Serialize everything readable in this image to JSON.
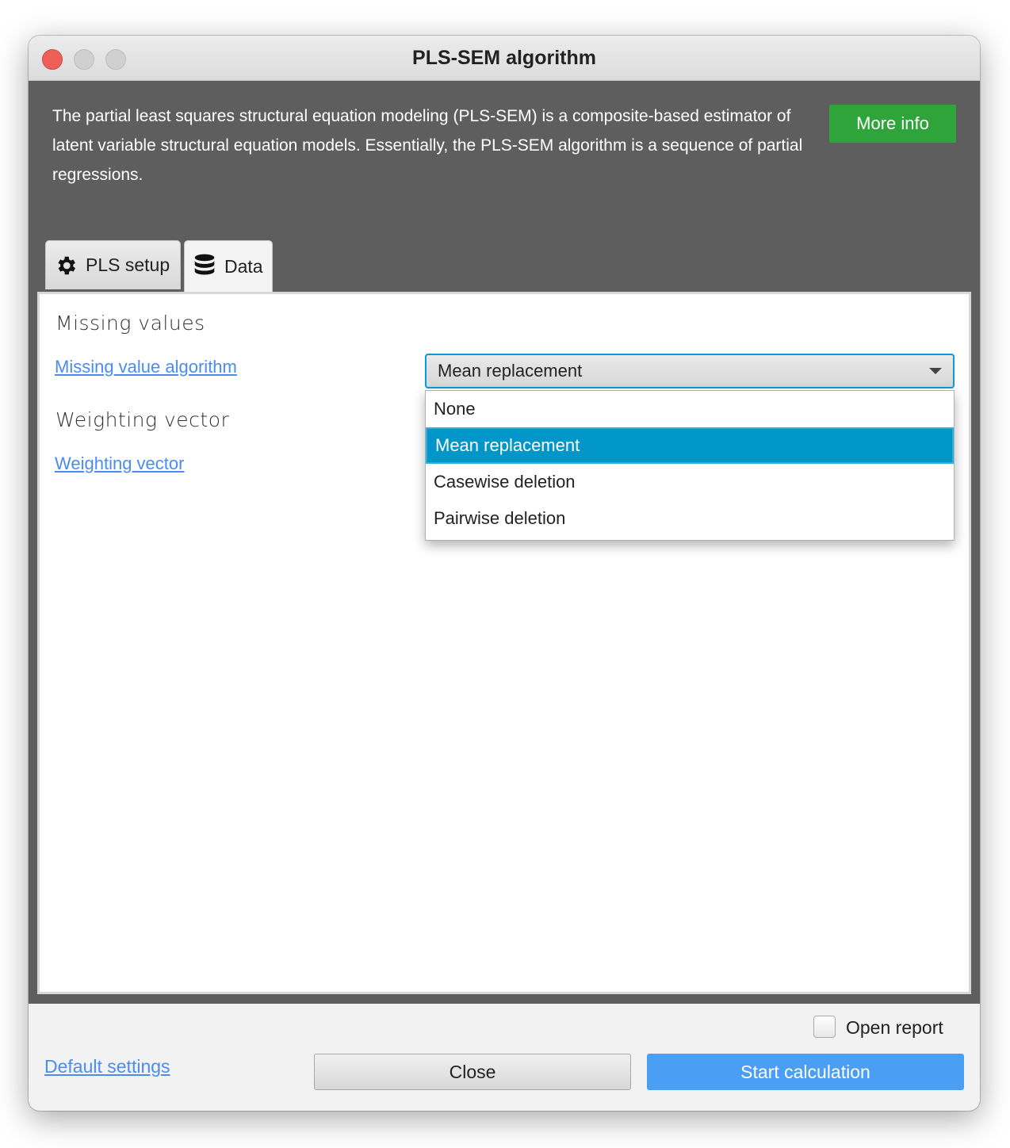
{
  "window": {
    "title": "PLS-SEM algorithm",
    "controls": [
      "close",
      "minimize",
      "zoom"
    ]
  },
  "header": {
    "description": "The partial least squares structural equation modeling (PLS-SEM) is a composite-based estimator of latent variable structural equation models. Essentially, the PLS-SEM algorithm is a sequence of partial regressions.",
    "more_info_label": "More info",
    "accent": "#2ea43a"
  },
  "tabs": [
    {
      "label": "PLS setup",
      "icon": "gear-icon",
      "active": false
    },
    {
      "label": "Data",
      "icon": "database-icon",
      "active": true
    }
  ],
  "data_tab": {
    "missing_values_heading": "Missing values",
    "missing_value_algorithm_link": "Missing value algorithm",
    "weighting_vector_heading": "Weighting vector",
    "weighting_vector_link": "Weighting vector",
    "missing_value_select": {
      "selected": "Mean replacement",
      "options": [
        "None",
        "Mean replacement",
        "Casewise deletion",
        "Pairwise deletion"
      ],
      "open": true,
      "highlight": "#0096c9"
    }
  },
  "footer": {
    "open_report_label": "Open report",
    "open_report_checked": false,
    "default_settings_label": "Default settings",
    "close_label": "Close",
    "start_label": "Start calculation",
    "start_color": "#4a9ff5"
  }
}
